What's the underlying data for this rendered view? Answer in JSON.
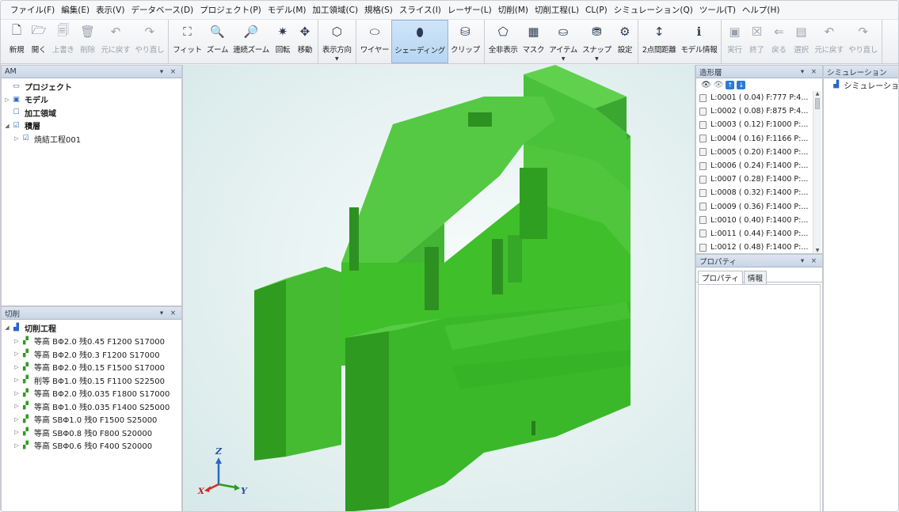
{
  "menu": [
    "ファイル(F)",
    "編集(E)",
    "表示(V)",
    "データベース(D)",
    "プロジェクト(P)",
    "モデル(M)",
    "加工領域(C)",
    "規格(S)",
    "スライス(I)",
    "レーザー(L)",
    "切削(M)",
    "切削工程(L)",
    "CL(P)",
    "シミュレーション(Q)",
    "ツール(T)",
    "ヘルプ(H)"
  ],
  "toolbar": {
    "groups": [
      [
        {
          "label": "新規",
          "icon": "new-file-icon",
          "glyph": "🗋",
          "disabled": false
        },
        {
          "label": "開く",
          "icon": "open-file-icon",
          "glyph": "🗁",
          "disabled": false
        },
        {
          "label": "上書き",
          "icon": "save-icon",
          "glyph": "🗐",
          "disabled": true
        },
        {
          "label": "削除",
          "icon": "trash-icon",
          "glyph": "🗑",
          "disabled": true
        },
        {
          "label": "元に戻す",
          "icon": "undo-icon",
          "glyph": "↶",
          "disabled": true
        },
        {
          "label": "やり直し",
          "icon": "redo-icon",
          "glyph": "↷",
          "disabled": true
        }
      ],
      [
        {
          "label": "フィット",
          "icon": "fit-icon",
          "glyph": "⛶",
          "disabled": false
        },
        {
          "label": "ズーム",
          "icon": "zoom-icon",
          "glyph": "🔍",
          "disabled": false
        },
        {
          "label": "連続ズーム",
          "icon": "continuous-zoom-icon",
          "glyph": "🔎",
          "disabled": false
        },
        {
          "label": "回転",
          "icon": "rotate-icon",
          "glyph": "✷",
          "disabled": false
        },
        {
          "label": "移動",
          "icon": "move-icon",
          "glyph": "✥",
          "disabled": false
        }
      ],
      [
        {
          "label": "表示方向",
          "icon": "view-direction-icon",
          "glyph": "⬡",
          "disabled": false,
          "dropdown": true
        }
      ],
      [
        {
          "label": "ワイヤー",
          "icon": "wireframe-icon",
          "glyph": "⬭",
          "disabled": false
        },
        {
          "label": "シェーディング",
          "icon": "shading-icon",
          "glyph": "⬮",
          "disabled": false,
          "active": true
        },
        {
          "label": "クリップ",
          "icon": "clip-icon",
          "glyph": "⛁",
          "disabled": false
        }
      ],
      [
        {
          "label": "全非表示",
          "icon": "hide-all-icon",
          "glyph": "⬠",
          "disabled": false
        },
        {
          "label": "マスク",
          "icon": "mask-icon",
          "glyph": "▦",
          "disabled": false
        },
        {
          "label": "アイテム",
          "icon": "item-icon",
          "glyph": "⛀",
          "disabled": false,
          "dropdown": true
        },
        {
          "label": "スナップ",
          "icon": "snap-icon",
          "glyph": "⛃",
          "disabled": false,
          "dropdown": true
        },
        {
          "label": "設定",
          "icon": "gear-icon",
          "glyph": "⚙",
          "disabled": false
        }
      ],
      [
        {
          "label": "2点間距離",
          "icon": "distance-icon",
          "glyph": "↕",
          "disabled": false
        },
        {
          "label": "モデル情報",
          "icon": "info-icon",
          "glyph": "ℹ",
          "disabled": false
        }
      ],
      [
        {
          "label": "実行",
          "icon": "run-icon",
          "glyph": "▣",
          "disabled": true
        },
        {
          "label": "終了",
          "icon": "stop-icon",
          "glyph": "☒",
          "disabled": true
        },
        {
          "label": "戻る",
          "icon": "back-icon",
          "glyph": "⇐",
          "disabled": true
        },
        {
          "label": "選択",
          "icon": "select-icon",
          "glyph": "▤",
          "disabled": true
        },
        {
          "label": "元に戻す",
          "icon": "undo-icon",
          "glyph": "↶",
          "disabled": true
        },
        {
          "label": "やり直し",
          "icon": "redo-icon",
          "glyph": "↷",
          "disabled": true
        }
      ]
    ]
  },
  "left_panel": {
    "title": "AM",
    "ctrls": "▾ ×",
    "items": [
      {
        "label": "プロジェクト",
        "arrow": "",
        "icon": "project-icon",
        "glyph": "▭",
        "bold": true,
        "indent": 0
      },
      {
        "label": "モデル",
        "arrow": "▷",
        "icon": "model-icon",
        "glyph": "▣",
        "bold": true,
        "indent": 0
      },
      {
        "label": "加工領域",
        "arrow": "",
        "icon": "region-icon",
        "glyph": "☐",
        "bold": true,
        "indent": 0
      },
      {
        "label": "積層",
        "arrow": "◢",
        "icon": "layer-icon",
        "glyph": "☑",
        "bold": true,
        "indent": 0
      },
      {
        "label": "焼結工程001",
        "arrow": "▷",
        "icon": "sinter-process-icon",
        "glyph": "☑",
        "bold": false,
        "indent": 1
      }
    ]
  },
  "cut_panel": {
    "title": "切削",
    "ctrls": "▾ ×",
    "root": "切削工程",
    "items": [
      "等高 BΦ2.0 残0.45 F1200 S17000",
      "等高 BΦ2.0 残0.3 F1200 S17000",
      "等高 BΦ2.0 残0.15 F1500 S17000",
      "削等 BΦ1.0 残0.15 F1100 S22500",
      "等高 BΦ2.0 残0.035 F1800 S17000",
      "等高 BΦ1.0 残0.035 F1400 S25000",
      "等高 SBΦ1.0 残0 F1500 S25000",
      "等高 SBΦ0.8 残0 F800 S20000",
      "等高 SBΦ0.6 残0 F400 S20000"
    ]
  },
  "layers_panel": {
    "title": "造形層",
    "ctrls": "▾ ×",
    "rows": [
      "L:0001 ( 0.04) F:777 P:4...",
      "L:0002 ( 0.08) F:875 P:4...",
      "L:0003 ( 0.12) F:1000 P:...",
      "L:0004 ( 0.16) F:1166 P:...",
      "L:0005 ( 0.20) F:1400 P:...",
      "L:0006 ( 0.24) F:1400 P:...",
      "L:0007 ( 0.28) F:1400 P:...",
      "L:0008 ( 0.32) F:1400 P:...",
      "L:0009 ( 0.36) F:1400 P:...",
      "L:0010 ( 0.40) F:1400 P:...",
      "L:0011 ( 0.44) F:1400 P:...",
      "L:0012 ( 0.48) F:1400 P:..."
    ]
  },
  "props_panel": {
    "title": "プロパティ",
    "ctrls": "▾ ×",
    "tabs": [
      "プロパティ",
      "情報"
    ]
  },
  "sim_panel": {
    "title": "シミュレーション",
    "item": "シミュレーショ"
  },
  "axes": {
    "z": "Z",
    "y": "Y",
    "x": "X"
  },
  "colors": {
    "model": "#3fbf2a",
    "accent": "#2b66c4"
  }
}
